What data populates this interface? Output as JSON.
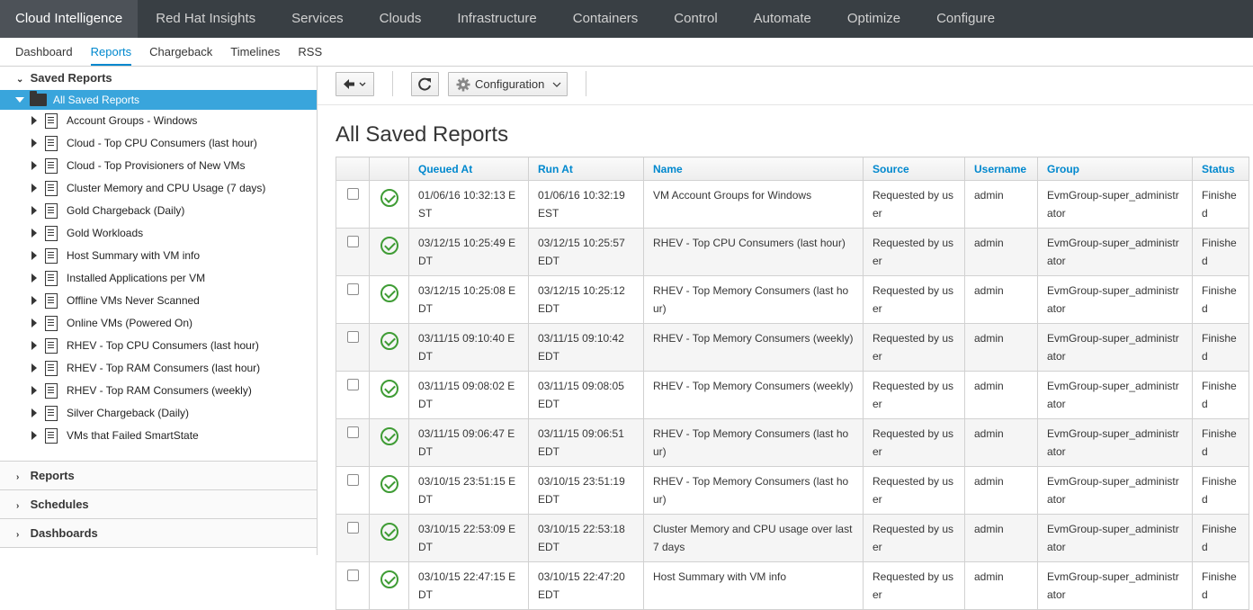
{
  "topnav": {
    "items": [
      "Cloud Intelligence",
      "Red Hat Insights",
      "Services",
      "Clouds",
      "Infrastructure",
      "Containers",
      "Control",
      "Automate",
      "Optimize",
      "Configure"
    ]
  },
  "subnav": {
    "items": [
      "Dashboard",
      "Reports",
      "Chargeback",
      "Timelines",
      "RSS"
    ]
  },
  "sidebar": {
    "saved_reports_label": "Saved Reports",
    "root_label": "All Saved Reports",
    "nodes": [
      "Account Groups - Windows",
      "Cloud - Top CPU Consumers (last hour)",
      "Cloud - Top Provisioners of New VMs",
      "Cluster Memory and CPU Usage (7 days)",
      "Gold Chargeback (Daily)",
      "Gold Workloads",
      "Host Summary with VM info",
      "Installed Applications per VM",
      "Offline VMs Never Scanned",
      "Online VMs (Powered On)",
      "RHEV - Top CPU Consumers (last hour)",
      "RHEV - Top RAM Consumers (last hour)",
      "RHEV - Top RAM Consumers (weekly)",
      "Silver Chargeback (Daily)",
      "VMs that Failed SmartState"
    ],
    "reports_label": "Reports",
    "schedules_label": "Schedules",
    "dashboards_label": "Dashboards"
  },
  "toolbar": {
    "back_icon": "arrow-left-icon",
    "reload_icon": "refresh-icon",
    "config_label": "Configuration",
    "config_icon": "gear-icon"
  },
  "main": {
    "title": "All Saved Reports",
    "columns": [
      "Queued At",
      "Run At",
      "Name",
      "Source",
      "Username",
      "Group",
      "Status"
    ],
    "rows": [
      {
        "queued": "01/06/16 10:32:13 EST",
        "run": "01/06/16 10:32:19 EST",
        "name": "VM Account Groups for Windows",
        "source": "Requested by user",
        "user": "admin",
        "group": "EvmGroup-super_administrator",
        "status": "Finished"
      },
      {
        "queued": "03/12/15 10:25:49 EDT",
        "run": "03/12/15 10:25:57 EDT",
        "name": "RHEV - Top CPU Consumers (last hour)",
        "source": "Requested by user",
        "user": "admin",
        "group": "EvmGroup-super_administrator",
        "status": "Finished"
      },
      {
        "queued": "03/12/15 10:25:08 EDT",
        "run": "03/12/15 10:25:12 EDT",
        "name": "RHEV - Top Memory Consumers (last hour)",
        "source": "Requested by user",
        "user": "admin",
        "group": "EvmGroup-super_administrator",
        "status": "Finished"
      },
      {
        "queued": "03/11/15 09:10:40 EDT",
        "run": "03/11/15 09:10:42 EDT",
        "name": "RHEV - Top Memory Consumers (weekly)",
        "source": "Requested by user",
        "user": "admin",
        "group": "EvmGroup-super_administrator",
        "status": "Finished"
      },
      {
        "queued": "03/11/15 09:08:02 EDT",
        "run": "03/11/15 09:08:05 EDT",
        "name": "RHEV - Top Memory Consumers (weekly)",
        "source": "Requested by user",
        "user": "admin",
        "group": "EvmGroup-super_administrator",
        "status": "Finished"
      },
      {
        "queued": "03/11/15 09:06:47 EDT",
        "run": "03/11/15 09:06:51 EDT",
        "name": "RHEV - Top Memory Consumers (last hour)",
        "source": "Requested by user",
        "user": "admin",
        "group": "EvmGroup-super_administrator",
        "status": "Finished"
      },
      {
        "queued": "03/10/15 23:51:15 EDT",
        "run": "03/10/15 23:51:19 EDT",
        "name": "RHEV - Top Memory Consumers (last hour)",
        "source": "Requested by user",
        "user": "admin",
        "group": "EvmGroup-super_administrator",
        "status": "Finished"
      },
      {
        "queued": "03/10/15 22:53:09 EDT",
        "run": "03/10/15 22:53:18 EDT",
        "name": "Cluster Memory and CPU usage over last 7 days",
        "source": "Requested by user",
        "user": "admin",
        "group": "EvmGroup-super_administrator",
        "status": "Finished"
      },
      {
        "queued": "03/10/15 22:47:15 EDT",
        "run": "03/10/15 22:47:20 EDT",
        "name": "Host Summary with VM info",
        "source": "Requested by user",
        "user": "admin",
        "group": "EvmGroup-super_administrator",
        "status": "Finished"
      }
    ]
  }
}
